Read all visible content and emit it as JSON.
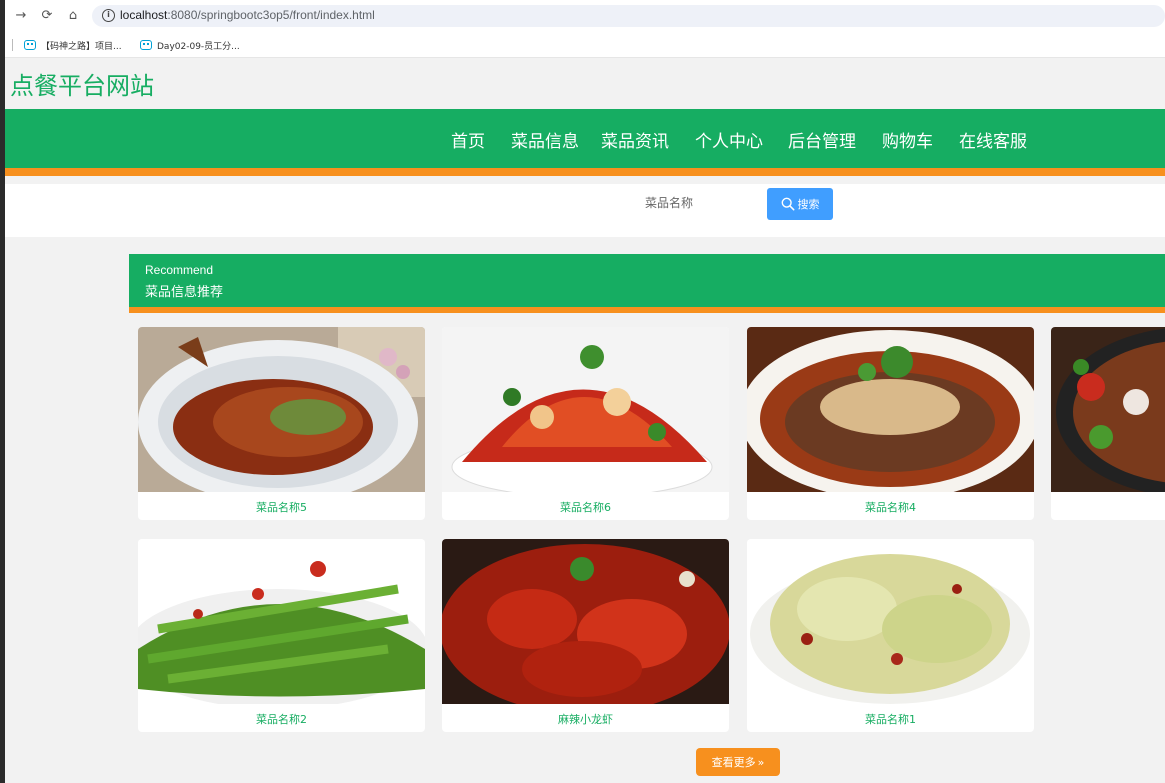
{
  "browser": {
    "url_host": "localhost",
    "url_path": ":8080/springbootc3op5/front/index.html",
    "bookmarks": [
      {
        "label": "【码神之路】项目..."
      },
      {
        "label": "Day02-09-员工分..."
      }
    ]
  },
  "site": {
    "title": "点餐平台网站",
    "accent_color": "#16ad62",
    "secondary_color": "#f7901e"
  },
  "nav": {
    "items": [
      {
        "label": "首页"
      },
      {
        "label": "菜品信息"
      },
      {
        "label": "菜品资讯"
      },
      {
        "label": "个人中心"
      },
      {
        "label": "后台管理"
      },
      {
        "label": "购物车"
      },
      {
        "label": "在线客服"
      }
    ]
  },
  "search": {
    "placeholder": "菜品名称",
    "button_label": "搜索"
  },
  "recommend": {
    "title_en": "Recommend",
    "title_cn": "菜品信息推荐",
    "cards": [
      {
        "name": "菜品名称5",
        "image": "braised-fish"
      },
      {
        "name": "菜品名称6",
        "image": "spicy-chili-dish"
      },
      {
        "name": "菜品名称4",
        "image": "sliced-beef-sesame"
      },
      {
        "name": "",
        "image": "stir-fried-pepper-meat"
      },
      {
        "name": "菜品名称2",
        "image": "dry-fried-green-beans"
      },
      {
        "name": "麻辣小龙虾",
        "image": "spicy-crayfish"
      },
      {
        "name": "菜品名称1",
        "image": "stir-fried-cabbage"
      }
    ],
    "more_label": "查看更多"
  }
}
